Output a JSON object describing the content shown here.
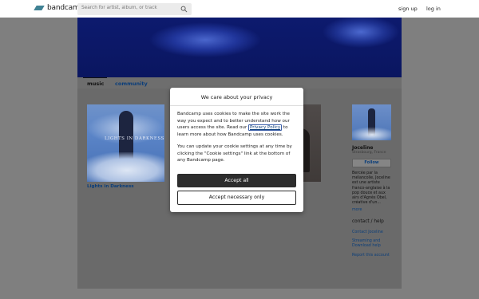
{
  "topbar": {
    "logo_text": "bandcamp",
    "search_placeholder": "Search for artist, album, or track",
    "signup_label": "sign up",
    "login_label": "log in"
  },
  "tabs": {
    "music": "music",
    "community": "community"
  },
  "release": {
    "title": "Lights in Darkness",
    "art_text": "LIGHTS IN DARKNESS"
  },
  "artist": {
    "name": "Joceline",
    "location": "Strasbourg, France",
    "follow_label": "Follow",
    "bio": "Bercée par la mélancolie, Joceline est une artiste franco-anglaise à la pop douce et aux airs d'Agnès Obel, créative d'un...",
    "more_label": "more",
    "contact_heading": "contact / help",
    "links": [
      "Contact Joceline",
      "Streaming and Download help",
      "Report this account"
    ]
  },
  "privacy_modal": {
    "title": "We care about your privacy",
    "para1_before": "Bandcamp uses cookies to make the site work the way you expect and to better understand how our users access the site. Read our ",
    "policy_link": "Privacy Policy",
    "para1_after": " to learn more about how Bandcamp uses cookies.",
    "para2": "You can update your cookie settings at any time by clicking the \"Cookie settings\" link at the bottom of any Bandcamp page.",
    "accept_all_label": "Accept all",
    "accept_necessary_label": "Accept necessary only"
  },
  "colors": {
    "brand": "#408294",
    "link": "#0b3e7a",
    "overlay": "#7f7f7f",
    "button_dark": "#2d2d2d"
  }
}
